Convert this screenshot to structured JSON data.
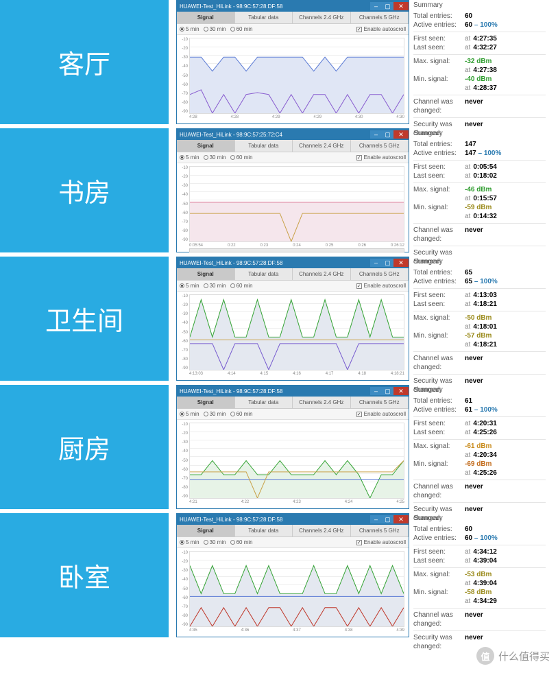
{
  "watermark": "什么值得买",
  "watermark_badge": "值",
  "yticks": [
    "-10",
    "-20",
    "-30",
    "-40",
    "-50",
    "-60",
    "-70",
    "-80",
    "-90"
  ],
  "rows": [
    {
      "label": "客厅",
      "title": "HUAWEI-Test_HiLink - 98:9C:57:28:DF:58",
      "tabs": [
        "Signal",
        "Tabular data",
        "Channels 2.4 GHz",
        "Channels 5 GHz"
      ],
      "radios": [
        "5 min",
        "30 min",
        "60 min"
      ],
      "autoscroll": "Enable autoscroll",
      "xticks": [
        "4:28",
        "4:28",
        "4:29",
        "4:29",
        "4:30",
        "4:30"
      ],
      "chart_data": {
        "type": "line",
        "ylim": [
          -90,
          -10
        ],
        "series": [
          {
            "name": "sig1",
            "color": "#5b7bd5",
            "values": [
              -30,
              -30,
              -45,
              -30,
              -30,
              -45,
              -30,
              -30,
              -30,
              -30,
              -30,
              -45,
              -30,
              -45,
              -30,
              -30,
              -30,
              -30,
              -30,
              -30
            ]
          },
          {
            "name": "sig2",
            "color": "#8a5fd0",
            "values": [
              -70,
              -65,
              -90,
              -70,
              -90,
              -70,
              -68,
              -70,
              -90,
              -70,
              -90,
              -70,
              -70,
              -90,
              -70,
              -90,
              -70,
              -70,
              -90,
              -70
            ]
          }
        ],
        "fill": "#e0e6f5"
      },
      "summary": {
        "title": "Summary",
        "total_label": "Total entries:",
        "total": "60",
        "active_label": "Active entries:",
        "active": "60",
        "pct": "100%",
        "first_label": "First seen:",
        "first": "4:27:35",
        "last_label": "Last seen:",
        "last": "4:32:27",
        "max_label": "Max. signal:",
        "max": "-32 dBm",
        "max_class": "sig-green",
        "max_at": "4:27:38",
        "min_label": "Min. signal:",
        "min": "-40 dBm",
        "min_class": "sig-green",
        "min_at": "4:28:37",
        "chan_label": "Channel was changed:",
        "chan": "never",
        "sec_label": "Security was changed:",
        "sec": "never",
        "at": "at",
        "dash": "–"
      }
    },
    {
      "label": "书房",
      "title": "HUAWEI-Test_HiLink - 98:9C:57:25:72:C4",
      "tabs": [
        "Signal",
        "Tabular data",
        "Channels 2.4 GHz",
        "Channels 5 GHz"
      ],
      "radios": [
        "5 min",
        "30 min",
        "60 min"
      ],
      "autoscroll": "Enable autoscroll",
      "xticks": [
        "0:05:54",
        "0:22",
        "0:23",
        "0:24",
        "0:25",
        "0:26",
        "0:26:12"
      ],
      "scrollbar": true,
      "chart_data": {
        "type": "line",
        "ylim": [
          -90,
          -10
        ],
        "series": [
          {
            "name": "sig1",
            "color": "#d96c8e",
            "values": [
              -48,
              -48,
              -48,
              -48,
              -48,
              -48,
              -48,
              -48,
              -48,
              -48,
              -48,
              -48,
              -48,
              -48,
              -48,
              -48,
              -48,
              -48,
              -48,
              -48
            ]
          },
          {
            "name": "sig2",
            "color": "#c9a24a",
            "values": [
              -60,
              -60,
              -60,
              -60,
              -60,
              -60,
              -60,
              -60,
              -60,
              -90,
              -60,
              -60,
              -60,
              -60,
              -60,
              -60,
              -60,
              -60,
              -60,
              -60
            ]
          }
        ],
        "fill": "#f5e6ec"
      },
      "summary": {
        "title": "Summary",
        "total_label": "Total entries:",
        "total": "147",
        "active_label": "Active entries:",
        "active": "147",
        "pct": "100%",
        "first_label": "First seen:",
        "first": "0:05:54",
        "last_label": "Last seen:",
        "last": "0:18:02",
        "max_label": "Max. signal:",
        "max": "-46 dBm",
        "max_class": "sig-green",
        "max_at": "0:15:57",
        "min_label": "Min. signal:",
        "min": "-59 dBm",
        "min_class": "sig-olive",
        "min_at": "0:14:32",
        "chan_label": "Channel was changed:",
        "chan": "never",
        "sec_label": "Security was changed:",
        "sec": "",
        "at": "at",
        "dash": "–"
      }
    },
    {
      "label": "卫生间",
      "title": "HUAWEI-Test_HiLink - 98:9C:57:28:DF:58",
      "tabs": [
        "Signal",
        "Tabular data",
        "Channels 2.4 GHz",
        "Channels 5 GHz"
      ],
      "radios": [
        "5 min",
        "30 min",
        "60 min"
      ],
      "autoscroll": "Enable autoscroll",
      "xticks": [
        "4:13:03",
        "4:14",
        "4:15",
        "4:16",
        "4:17",
        "4:18",
        "4:18:21"
      ],
      "chart_data": {
        "type": "line",
        "ylim": [
          -90,
          -10
        ],
        "series": [
          {
            "name": "sig1",
            "color": "#3aa63a",
            "values": [
              -55,
              -15,
              -55,
              -15,
              -55,
              -55,
              -15,
              -55,
              -55,
              -15,
              -55,
              -55,
              -15,
              -55,
              -55,
              -15,
              -55,
              -15,
              -55,
              -55
            ]
          },
          {
            "name": "sig2",
            "color": "#7a5fd0",
            "values": [
              -62,
              -62,
              -62,
              -90,
              -62,
              -62,
              -62,
              -90,
              -62,
              -62,
              -62,
              -62,
              -62,
              -62,
              -90,
              -62,
              -62,
              -62,
              -62,
              -62
            ]
          },
          {
            "name": "sig3",
            "color": "#c9a24a",
            "values": [
              -58,
              -58,
              -58,
              -58,
              -58,
              -58,
              -58,
              -58,
              -58,
              -58,
              -58,
              -58,
              -58,
              -58,
              -58,
              -58,
              -58,
              -58,
              -58,
              -58
            ]
          }
        ],
        "fill": "#e4e8f0"
      },
      "summary": {
        "title": "Summary",
        "total_label": "Total entries:",
        "total": "65",
        "active_label": "Active entries:",
        "active": "65",
        "pct": "100%",
        "first_label": "First seen:",
        "first": "4:13:03",
        "last_label": "Last seen:",
        "last": "4:18:21",
        "max_label": "Max. signal:",
        "max": "-50 dBm",
        "max_class": "sig-olive",
        "max_at": "4:18:01",
        "min_label": "Min. signal:",
        "min": "-57 dBm",
        "min_class": "sig-olive",
        "min_at": "4:18:21",
        "chan_label": "Channel was changed:",
        "chan": "never",
        "sec_label": "Security was changed:",
        "sec": "never",
        "at": "at",
        "dash": "–"
      }
    },
    {
      "label": "厨房",
      "title": "HUAWEI-Test_HiLink - 98:9C:57:28:DF:58",
      "tabs": [
        "Signal",
        "Tabular data",
        "Channels 2.4 GHz",
        "Channels 5 GHz"
      ],
      "radios": [
        "5 min",
        "30 min",
        "60 min"
      ],
      "autoscroll": "Enable autoscroll",
      "xticks": [
        "4:21",
        "4:22",
        "4:23",
        "4:24",
        "4:25"
      ],
      "chart_data": {
        "type": "line",
        "ylim": [
          -90,
          -10
        ],
        "series": [
          {
            "name": "sig1",
            "color": "#3aa63a",
            "values": [
              -65,
              -65,
              -50,
              -65,
              -65,
              -50,
              -65,
              -65,
              -50,
              -65,
              -65,
              -65,
              -50,
              -65,
              -50,
              -65,
              -90,
              -65,
              -65,
              -50
            ]
          },
          {
            "name": "sig2",
            "color": "#5b7bd5",
            "values": [
              -70,
              -70,
              -70,
              -70,
              -70,
              -70,
              -70,
              -70,
              -70,
              -70,
              -70,
              -70,
              -70,
              -70,
              -70,
              -70,
              -70,
              -70,
              -70,
              -70
            ]
          },
          {
            "name": "sig3",
            "color": "#c9a24a",
            "values": [
              -62,
              -62,
              -62,
              -62,
              -62,
              -62,
              -90,
              -62,
              -62,
              -62,
              -62,
              -62,
              -62,
              -62,
              -62,
              -62,
              -62,
              -62,
              -62,
              -50
            ]
          }
        ],
        "fill": "#e7f3e7"
      },
      "summary": {
        "title": "Summary",
        "total_label": "Total entries:",
        "total": "61",
        "active_label": "Active entries:",
        "active": "61",
        "pct": "100%",
        "first_label": "First seen:",
        "first": "4:20:31",
        "last_label": "Last seen:",
        "last": "4:25:26",
        "max_label": "Max. signal:",
        "max": "-61 dBm",
        "max_class": "sig-orange",
        "max_at": "4:20:34",
        "min_label": "Min. signal:",
        "min": "-69 dBm",
        "min_class": "sig-dorange",
        "min_at": "4:25:26",
        "chan_label": "Channel was changed:",
        "chan": "never",
        "sec_label": "Security was changed:",
        "sec": "never",
        "at": "at",
        "dash": "–"
      }
    },
    {
      "label": "卧室",
      "title": "HUAWEI-Test_HiLink - 98:9C:57:28:DF:58",
      "tabs": [
        "Signal",
        "Tabular data",
        "Channels 2.4 GHz",
        "Channels 5 GHz"
      ],
      "radios": [
        "5 min",
        "30 min",
        "60 min"
      ],
      "autoscroll": "Enable autoscroll",
      "xticks": [
        "4:35",
        "4:36",
        "4:37",
        "4:38",
        "4:39"
      ],
      "chart_data": {
        "type": "line",
        "ylim": [
          -90,
          -10
        ],
        "series": [
          {
            "name": "sig1",
            "color": "#3aa63a",
            "values": [
              -25,
              -55,
              -25,
              -55,
              -55,
              -25,
              -55,
              -25,
              -55,
              -55,
              -55,
              -25,
              -55,
              -55,
              -25,
              -55,
              -25,
              -55,
              -25,
              -55
            ]
          },
          {
            "name": "sig2",
            "color": "#5b7bd5",
            "values": [
              -58,
              -58,
              -58,
              -58,
              -58,
              -58,
              -58,
              -58,
              -58,
              -58,
              -58,
              -58,
              -58,
              -58,
              -58,
              -58,
              -58,
              -58,
              -58,
              -58
            ]
          },
          {
            "name": "sig3",
            "color": "#c0392b",
            "values": [
              -90,
              -70,
              -90,
              -70,
              -90,
              -70,
              -90,
              -70,
              -70,
              -90,
              -70,
              -90,
              -70,
              -70,
              -90,
              -70,
              -90,
              -70,
              -90,
              -70
            ]
          }
        ],
        "fill": "#e4e8f0"
      },
      "summary": {
        "title": "Summary",
        "total_label": "Total entries:",
        "total": "60",
        "active_label": "Active entries:",
        "active": "60",
        "pct": "100%",
        "first_label": "First seen:",
        "first": "4:34:12",
        "last_label": "Last seen:",
        "last": "4:39:04",
        "max_label": "Max. signal:",
        "max": "-53 dBm",
        "max_class": "sig-olive",
        "max_at": "4:39:04",
        "min_label": "Min. signal:",
        "min": "-58 dBm",
        "min_class": "sig-olive",
        "min_at": "4:34:29",
        "chan_label": "Channel was changed:",
        "chan": "never",
        "sec_label": "Security was changed:",
        "sec": "never",
        "at": "at",
        "dash": "–"
      }
    }
  ]
}
